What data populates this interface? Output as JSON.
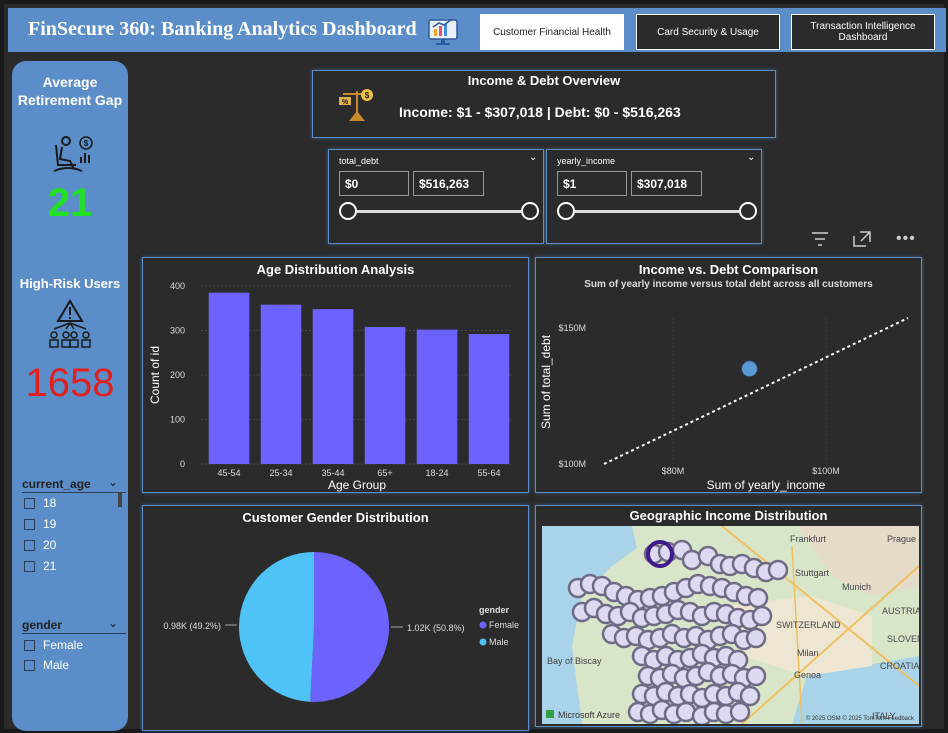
{
  "header": {
    "title": "FinSecure 360: Banking Analytics Dashboard",
    "tabs": [
      {
        "label": "Customer Financial Health",
        "active": true
      },
      {
        "label": "Card Security & Usage",
        "active": false
      },
      {
        "label": "Transaction Intelligence Dashboard",
        "active": false
      }
    ]
  },
  "sidebar": {
    "retirement_title": "Average Retirement Gap",
    "retirement_value": "21",
    "highrisk_title": "High-Risk Users",
    "highrisk_value": "1658",
    "age_slicer": {
      "label": "current_age",
      "options": [
        "18",
        "19",
        "20",
        "21"
      ]
    },
    "gender_slicer": {
      "label": "gender",
      "options": [
        "Female",
        "Male"
      ]
    }
  },
  "overview": {
    "title": "Income & Debt Overview",
    "text": "Income: $1 - $307,018 | Debt: $0 - $516,263"
  },
  "filters": {
    "debt": {
      "label": "total_debt",
      "min": "$0",
      "max": "$516,263"
    },
    "income": {
      "label": "yearly_income",
      "min": "$1",
      "max": "$307,018"
    }
  },
  "age_chart": {
    "title": "Age Distribution Analysis",
    "chart_data": {
      "type": "bar",
      "categories": [
        "45-54",
        "25-34",
        "35-44",
        "65+",
        "18-24",
        "55-64"
      ],
      "values": [
        385,
        358,
        348,
        308,
        302,
        292
      ],
      "xlabel": "Age Group",
      "ylabel": "Count of id",
      "yticks": [
        "0",
        "100",
        "200",
        "300",
        "400"
      ],
      "ylim": [
        0,
        400
      ],
      "color": "#6c63ff"
    }
  },
  "scatter_chart": {
    "title": "Income vs. Debt Comparison",
    "subtitle": "Sum of yearly income versus total debt across all customers",
    "chart_data": {
      "type": "scatter",
      "xlabel": "Sum of yearly_income",
      "ylabel": "Sum of total_debt",
      "xticks": [
        "$80M",
        "$100M"
      ],
      "yticks": [
        "$100M",
        "$150M"
      ],
      "points": [
        {
          "x": 90,
          "y": 135
        }
      ],
      "color": "#5b9bd5"
    }
  },
  "gender_chart": {
    "title": "Customer Gender Distribution",
    "chart_data": {
      "type": "pie",
      "legend_title": "gender",
      "labels": [
        "Female",
        "Male"
      ],
      "values": [
        50.8,
        49.2
      ],
      "data_labels": [
        "1.02K (50.8%)",
        "0.98K (49.2%)"
      ],
      "colors": [
        "#6c63ff",
        "#4fc3f7"
      ]
    }
  },
  "map": {
    "title": "Geographic Income Distribution",
    "place_labels": [
      "Frankfurt",
      "Prague",
      "Stuttgart",
      "Munich",
      "AUSTRIA",
      "SLOVENIA",
      "CROATIA",
      "SWITZERLAND",
      "Milan",
      "Genoa",
      "Bay of Biscay",
      "ITALY"
    ],
    "attribution": "Microsoft Azure",
    "copyright": "© 2025 OSM  © 2025 TomTom  Feedback"
  }
}
